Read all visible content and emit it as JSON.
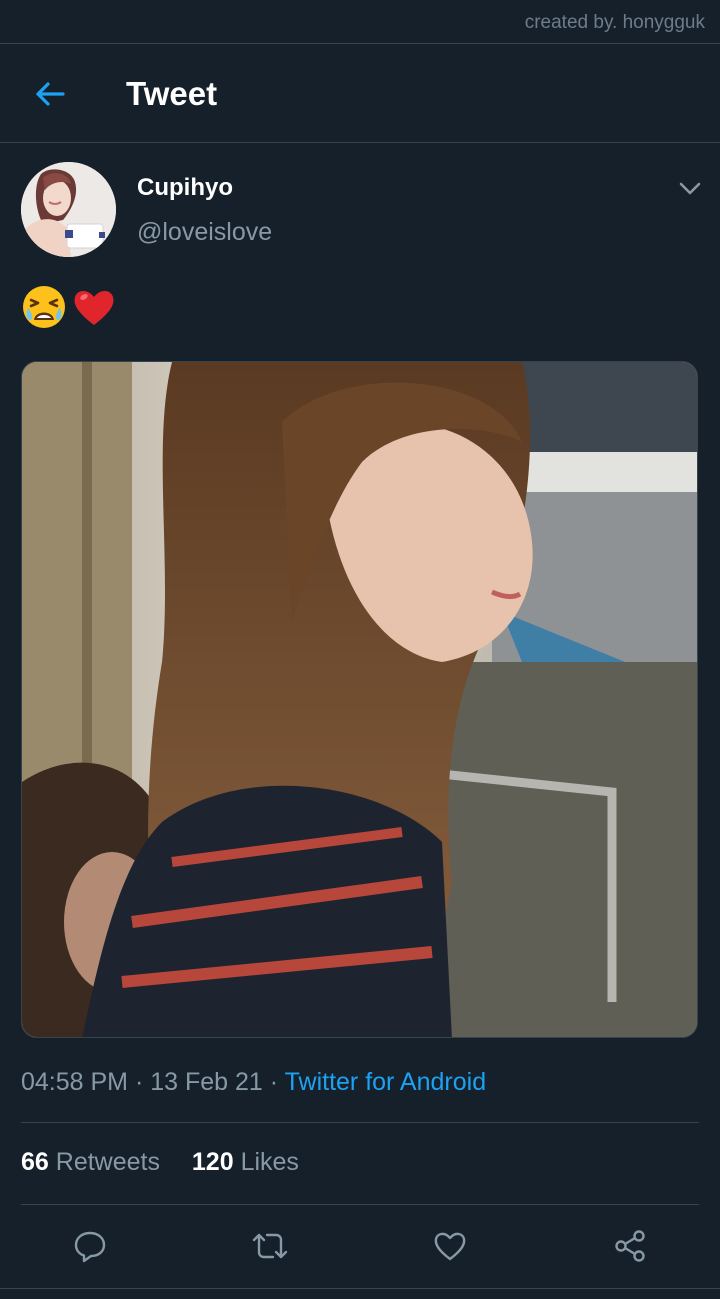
{
  "watermark": "created by. honygguk",
  "header": {
    "title": "Tweet",
    "back_icon": "arrow-left-icon"
  },
  "tweet": {
    "author": {
      "display_name": "Cupihyo",
      "handle": "@loveislove"
    },
    "text_emojis": [
      "tired-face-emoji",
      "red-heart-emoji"
    ],
    "time": "04:58 PM",
    "date": "13 Feb 21",
    "separator": "·",
    "source": "Twitter for Android",
    "stats": {
      "retweets_count": "66",
      "retweets_label": "Retweets",
      "likes_count": "120",
      "likes_label": "Likes"
    }
  },
  "actions": [
    "reply-icon",
    "retweet-icon",
    "like-icon",
    "share-icon"
  ],
  "colors": {
    "background": "#15202b",
    "divider": "#38444d",
    "accent": "#1da1f2",
    "secondary_text": "#8899a6"
  }
}
